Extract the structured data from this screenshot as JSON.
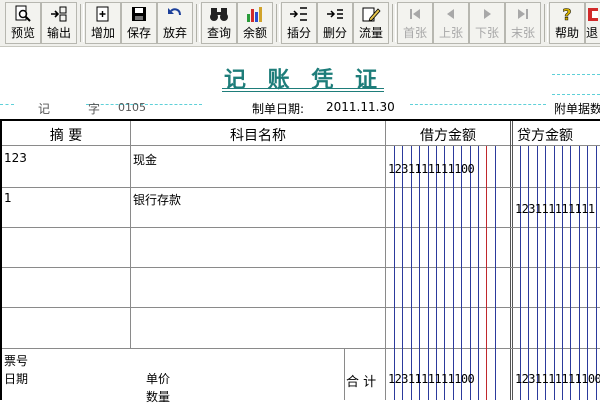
{
  "toolbar": {
    "buttons": [
      {
        "label": "预览",
        "icon": "preview-icon",
        "enabled": true
      },
      {
        "label": "输出",
        "icon": "export-icon",
        "enabled": true
      },
      {
        "label": "增加",
        "icon": "add-icon",
        "enabled": true
      },
      {
        "label": "保存",
        "icon": "save-icon",
        "enabled": true
      },
      {
        "label": "放弃",
        "icon": "undo-icon",
        "enabled": true
      },
      {
        "label": "查询",
        "icon": "binoculars-icon",
        "enabled": true
      },
      {
        "label": "余额",
        "icon": "bar-chart-icon",
        "enabled": true
      },
      {
        "label": "插分",
        "icon": "insert-entry-icon",
        "enabled": true
      },
      {
        "label": "删分",
        "icon": "delete-entry-icon",
        "enabled": true
      },
      {
        "label": "流量",
        "icon": "pencil-icon",
        "enabled": true
      },
      {
        "label": "首张",
        "icon": "first-icon",
        "enabled": false
      },
      {
        "label": "上张",
        "icon": "prev-icon",
        "enabled": false
      },
      {
        "label": "下张",
        "icon": "next-icon",
        "enabled": false
      },
      {
        "label": "末张",
        "icon": "last-icon",
        "enabled": false
      },
      {
        "label": "帮助",
        "icon": "help-icon",
        "enabled": true
      },
      {
        "label": "退",
        "icon": "exit-icon",
        "enabled": true
      }
    ]
  },
  "voucher": {
    "title": "记 账 凭 证",
    "type_label": "记",
    "number_label": "字",
    "number": "0105",
    "date_label": "制单日期:",
    "date": "2011.11.30",
    "attachments_label": "附单据数"
  },
  "table": {
    "headers": {
      "summary": "摘 要",
      "account": "科目名称",
      "debit": "借方金额",
      "credit": "贷方金额"
    },
    "rows": [
      {
        "summary": "123",
        "account": "现金",
        "debit": "1231111111100",
        "credit": ""
      },
      {
        "summary": "1",
        "account": "银行存款",
        "debit": "",
        "credit": "123111111111"
      },
      {
        "summary": "",
        "account": "",
        "debit": "",
        "credit": ""
      },
      {
        "summary": "",
        "account": "",
        "debit": "",
        "credit": ""
      },
      {
        "summary": "",
        "account": "",
        "debit": "",
        "credit": ""
      }
    ],
    "footer": {
      "ticket_label": "票号",
      "date_label": "日期",
      "price_label": "单价",
      "quantity_label": "数量",
      "total_label": "合 计",
      "debit_total": "1231111111100",
      "credit_total": "1231111111100"
    }
  },
  "colors": {
    "title": "#1e7d7a",
    "grid_blue": "#2c3a9c",
    "grid_red": "#c0282c",
    "dashed": "#5ed0d8"
  }
}
